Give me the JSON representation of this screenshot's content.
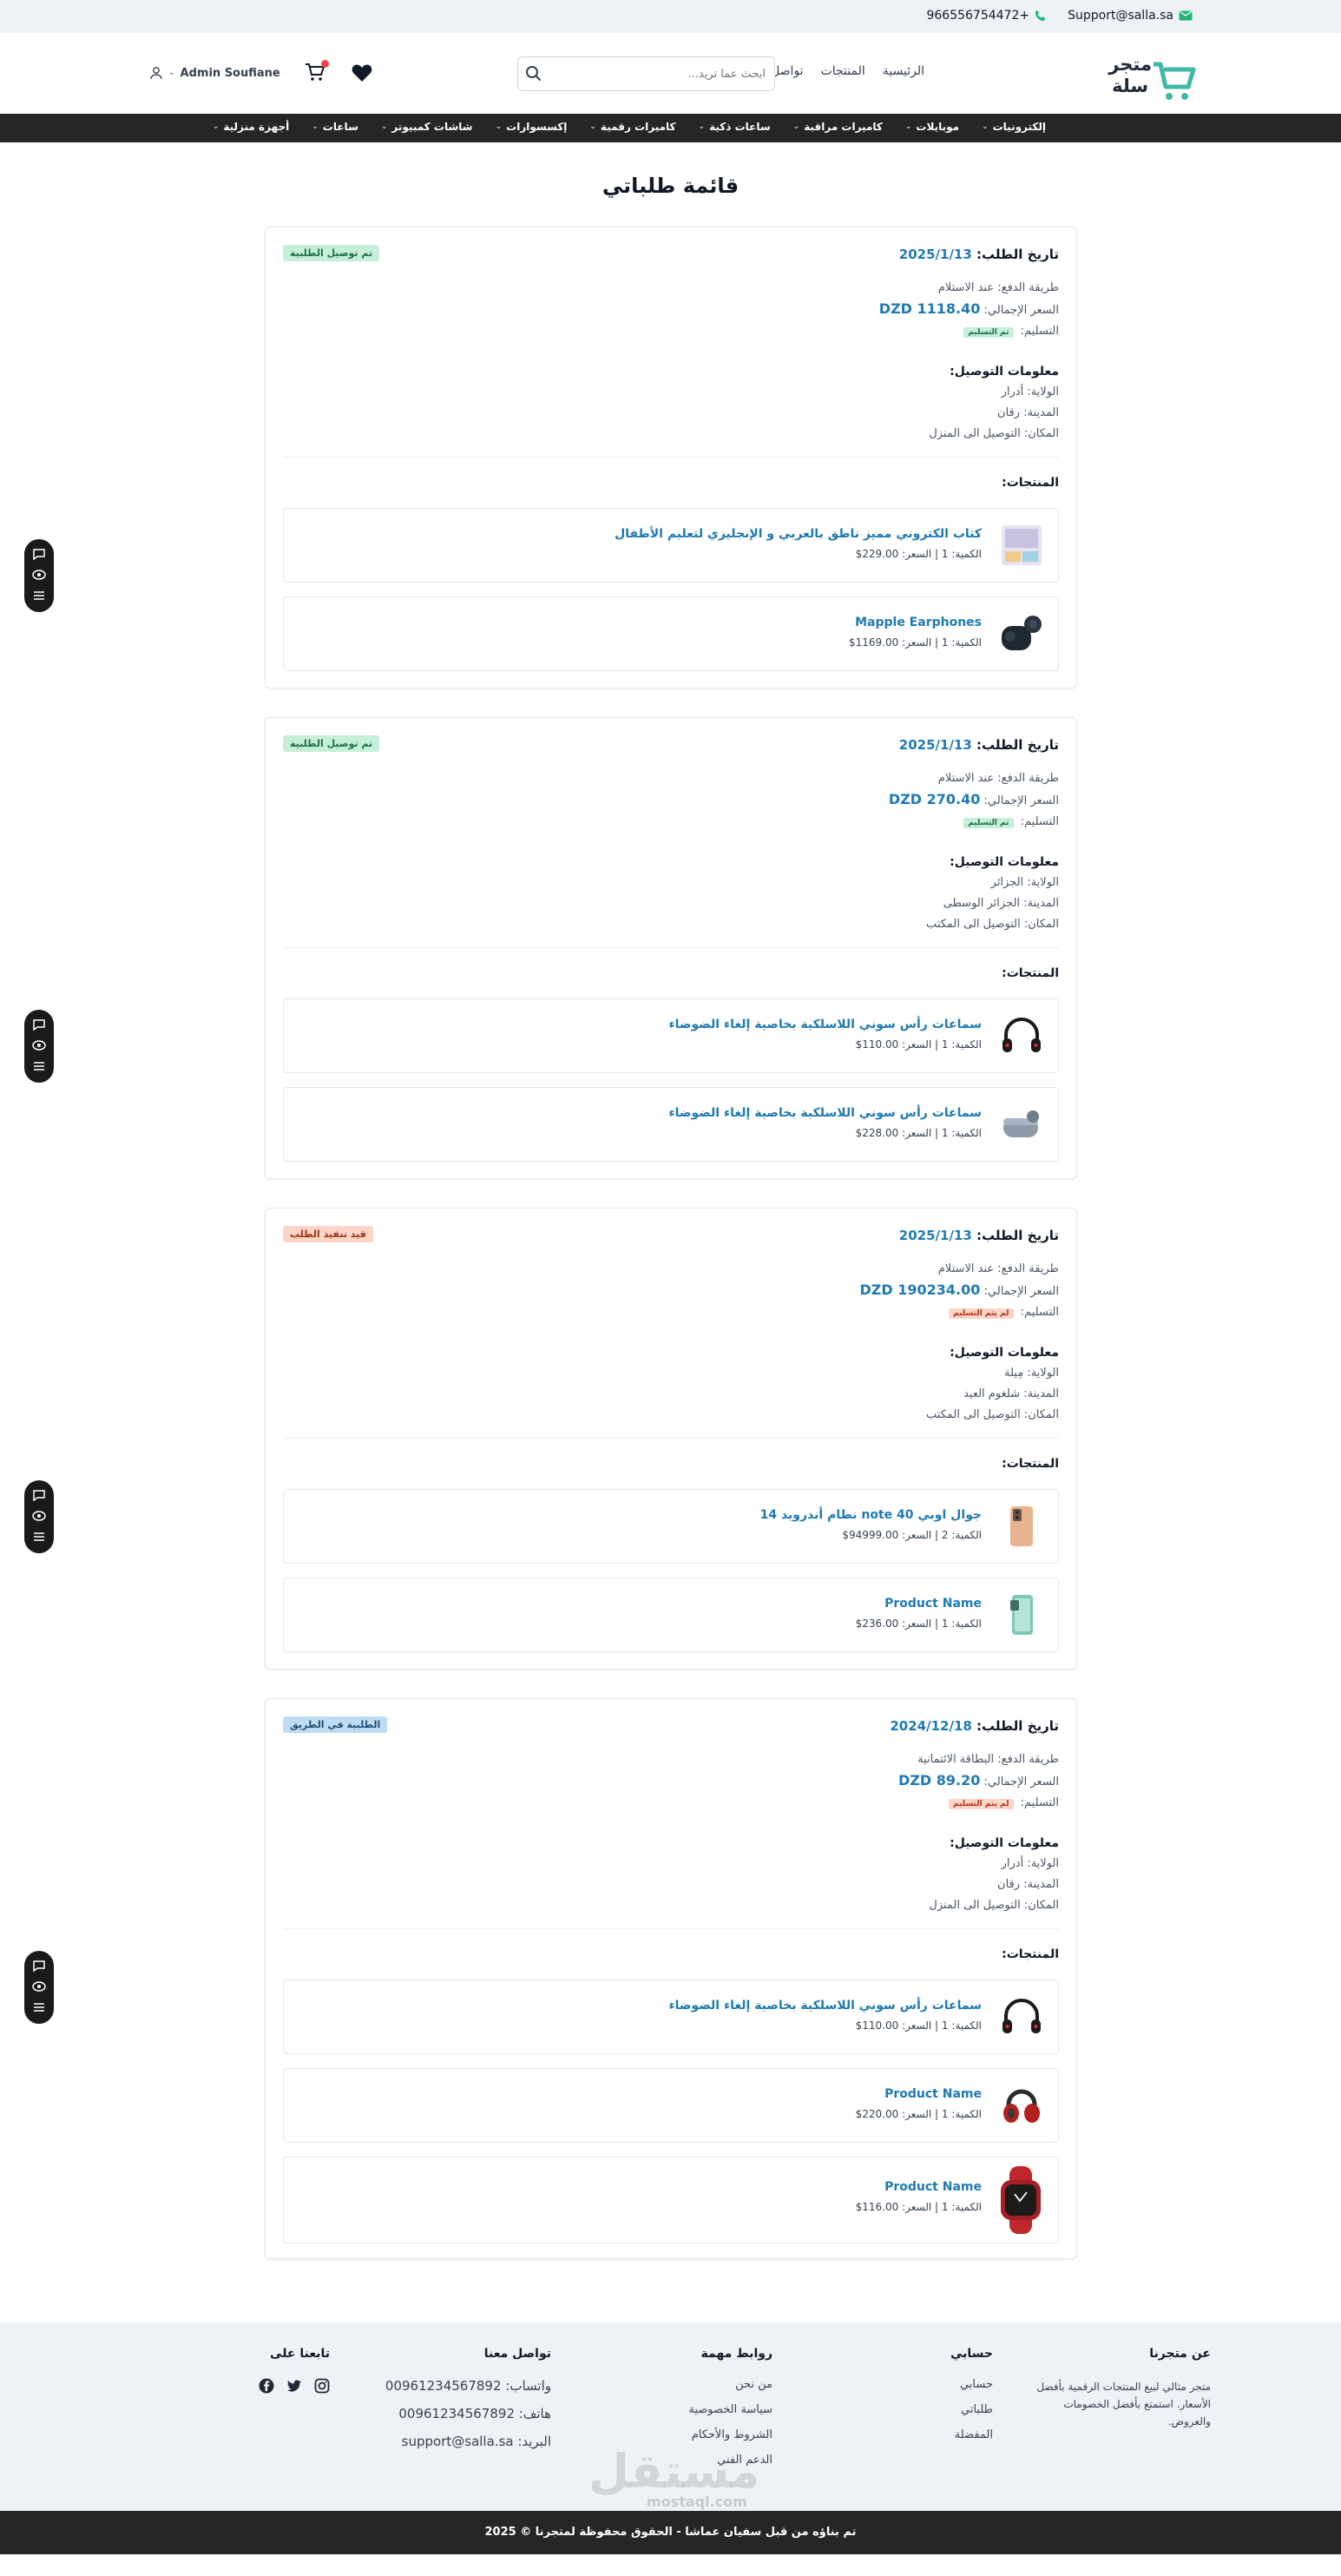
{
  "topbar": {
    "email": "Support@salla.sa",
    "phone": "966556754472+"
  },
  "header": {
    "logo_line1": "متجر",
    "logo_line2": "سلة",
    "nav": [
      "الرئيسية",
      "المنتجات",
      "تواصل معنا"
    ],
    "search_placeholder": "ابحث عما تريد...",
    "user_name": "Admin Soufiane",
    "cart_count": "0"
  },
  "categories": [
    "إلكترونيات",
    "موبايلات",
    "كاميرات مراقبة",
    "ساعات ذكية",
    "كاميرات رقمية",
    "إكسسوارات",
    "شاشات كمبيوتر",
    "ساعات",
    "أجهزة منزلية"
  ],
  "page_title": "قائمة طلباتي",
  "labels": {
    "order_date": "تاريخ الطلب:",
    "payment_method": "طريقة الدفع:",
    "total_price": "السعر الإجمالي:",
    "delivery": "التسليم:",
    "shipping_info": "معلومات التوصيل:",
    "state": "الولاية:",
    "city": "المدينة:",
    "place": "المكان:",
    "products": "المنتجات:"
  },
  "orders": [
    {
      "date": "2025/1/13",
      "status": "تم توصيل الطلبية",
      "payment": "عند الاستلام",
      "total": "DZD 1118.40",
      "delivery": "تم التسليم",
      "state": "أدرار",
      "city": "رقان",
      "place": "التوصيل الى المنزل",
      "products": [
        {
          "name": "كتاب الكتروني مميز ناطق بالعربي و الإنجليزي لتعليم الأطفال",
          "meta": "الكمية: 1 | السعر: 229.00$"
        },
        {
          "name": "Mapple Earphones",
          "meta": "الكمية: 1 | السعر: 1169.00$"
        }
      ]
    },
    {
      "date": "2025/1/13",
      "status": "تم توصيل الطلبية",
      "payment": "عند الاستلام",
      "total": "DZD 270.40",
      "delivery": "تم التسليم",
      "state": "الجزائر",
      "city": "الجزائر الوسطى",
      "place": "التوصيل الى المكتب",
      "products": [
        {
          "name": "سماعات رأس سوني اللاسلكية بخاصية إلغاء الضوضاء",
          "meta": "الكمية: 1 | السعر: 110.00$"
        },
        {
          "name": "سماعات رأس سوني اللاسلكية بخاصية إلغاء الضوضاء",
          "meta": "الكمية: 1 | السعر: 228.00$"
        }
      ]
    },
    {
      "date": "2025/1/13",
      "status": "قيد تنفيذ الطلب",
      "payment": "عند الاستلام",
      "total": "DZD 190234.00",
      "delivery": "لم يتم التسليم",
      "state": "مِيلة",
      "city": "شلغوم العيد",
      "place": "التوصيل الى المكتب",
      "products": [
        {
          "name": "جوال اوبي note 40 نظام أندرويد 14",
          "meta": "الكمية: 2 | السعر: 94999.00$"
        },
        {
          "name": "Product Name",
          "meta": "الكمية: 1 | السعر: 236.00$"
        }
      ]
    },
    {
      "date": "2024/12/18",
      "status": "الطلبية في الطريق",
      "payment": "البطاقة الائتمانية",
      "total": "DZD 89.20",
      "delivery": "لم يتم التسليم",
      "state": "أدرار",
      "city": "رقان",
      "place": "التوصيل الى المنزل",
      "products": [
        {
          "name": "سماعات رأس سوني اللاسلكية بخاصية إلغاء الضوضاء",
          "meta": "الكمية: 1 | السعر: 110.00$"
        },
        {
          "name": "Product Name",
          "meta": "الكمية: 1 | السعر: 220.00$"
        },
        {
          "name": "Product Name",
          "meta": "الكمية: 1 | السعر: 116.00$"
        }
      ]
    }
  ],
  "footer": {
    "about_title": "عن متجرنا",
    "about_text1": "متجر مثالي لبيع المنتجات الرقمية بأفضل",
    "about_text2": "الأسعار. استمتع بأفضل الخصومات والعروض.",
    "account_title": "حسابي",
    "account_links": [
      "حسابي",
      "طلباتي",
      "المفضلة"
    ],
    "links_title": "روابط مهمة",
    "links": [
      "من نحن",
      "سياسة الخصوصية",
      "الشروط والأحكام",
      "الدعم الفني"
    ],
    "contact_title": "تواصل معنا",
    "whatsapp": "واتساب: 00961234567892",
    "phone": "هاتف: 00961234567892",
    "email": "البريد: support@salla.sa",
    "follow_title": "تابعنا على",
    "copyright": "تم بناؤه من قبل سفيان عماشا - الحقوق محفوظة لمتجرنا © 2025",
    "watermark": "مستقل",
    "watermark_sub": "mostaql.com"
  }
}
